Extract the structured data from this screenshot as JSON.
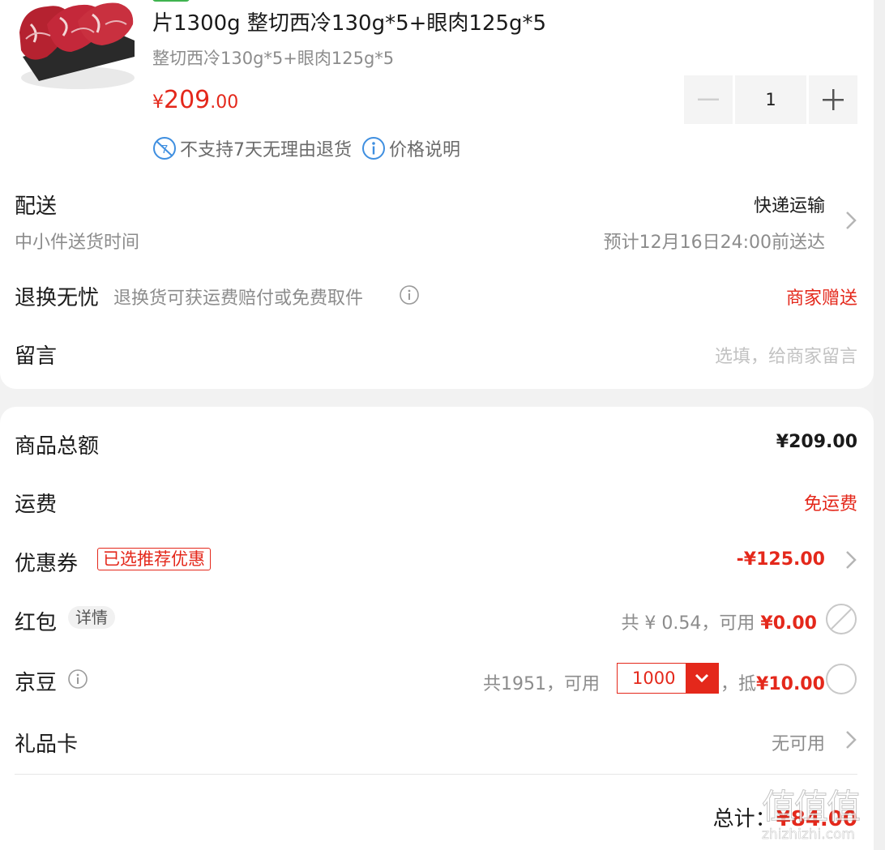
{
  "product": {
    "title": "片1300g 整切西冷130g*5+眼肉125g*5",
    "subtitle": "整切西冷130g*5+眼肉125g*5",
    "price_symbol": "¥",
    "price_int": "209",
    "price_dec": ".00",
    "quantity": "1",
    "policy_no_return": "不支持7天无理由退货",
    "policy_price_note": "价格说明",
    "image_icon": "steak-image-icon"
  },
  "delivery": {
    "label": "配送",
    "sublabel": "中小件送货时间",
    "method": "快递运输",
    "eta": "预计12月16日24:00前送达"
  },
  "returns": {
    "label": "退换无忧",
    "desc": "退换货可获运费赔付或免费取件",
    "value": "商家赠送"
  },
  "message": {
    "label": "留言",
    "placeholder": "选填，给商家留言"
  },
  "summary": {
    "goods_total_label": "商品总额",
    "goods_total_value": "¥209.00",
    "shipping_label": "运费",
    "shipping_value": "免运费",
    "coupon_label": "优惠券",
    "coupon_tag": "已选推荐优惠",
    "coupon_value": "-¥125.00",
    "redpacket_label": "红包",
    "redpacket_detail": "详情",
    "redpacket_info": "共 ¥ 0.54，可用",
    "redpacket_value": "¥0.00",
    "beans_label": "京豆",
    "beans_info": "共1951，可用",
    "beans_amount": "1000",
    "beans_deduct_prefix": "，抵",
    "beans_deduct_value": "¥10.00",
    "giftcard_label": "礼品卡",
    "giftcard_value": "无可用",
    "total_label": "总计：",
    "total_value": "¥84.00"
  },
  "watermark": {
    "text": "值值值",
    "site": "zhizhizhi.com"
  },
  "colors": {
    "accent_red": "#e4281b",
    "info_blue": "#3f8fe0",
    "tag_green": "#3fb34f"
  }
}
